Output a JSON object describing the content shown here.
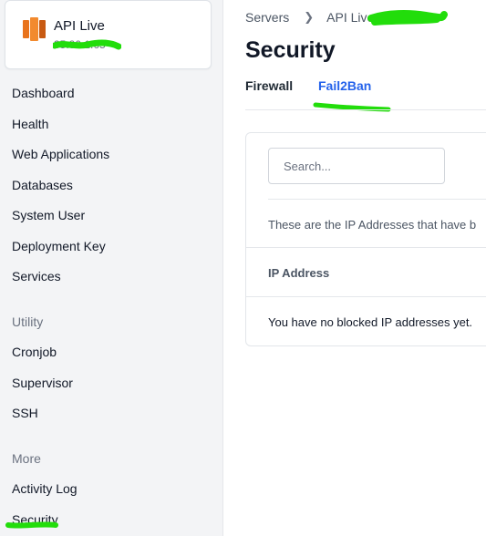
{
  "server": {
    "name": "API Live",
    "ip": "35.80.1.65",
    "icon": "aws-server-icon"
  },
  "sidebar": {
    "items": [
      {
        "label": "Dashboard"
      },
      {
        "label": "Health"
      },
      {
        "label": "Web Applications"
      },
      {
        "label": "Databases"
      },
      {
        "label": "System User"
      },
      {
        "label": "Deployment Key"
      },
      {
        "label": "Services"
      }
    ],
    "utility_heading": "Utility",
    "utility_items": [
      {
        "label": "Cronjob"
      },
      {
        "label": "Supervisor"
      },
      {
        "label": "SSH"
      }
    ],
    "more_heading": "More",
    "more_items": [
      {
        "label": "Activity Log"
      },
      {
        "label": "Security"
      }
    ]
  },
  "breadcrumb": {
    "root": "Servers",
    "current": "API Live"
  },
  "page": {
    "title": "Security",
    "tabs": [
      {
        "label": "Firewall",
        "active": false
      },
      {
        "label": "Fail2Ban",
        "active": true
      }
    ]
  },
  "panel": {
    "search_placeholder": "Search...",
    "description": "These are the IP Addresses that have b",
    "column_header": "IP Address",
    "empty_message": "You have no blocked IP addresses yet."
  },
  "colors": {
    "accent": "#2563eb",
    "highlight_scribble": "#22dd0b",
    "aws_orange": "#e8731c"
  }
}
